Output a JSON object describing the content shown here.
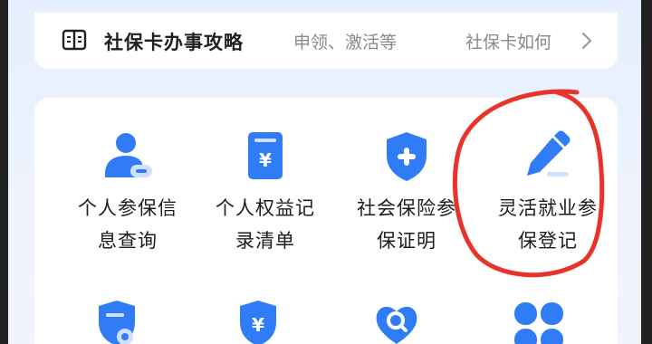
{
  "strategy": {
    "title": "社保卡办事攻略",
    "marquee_1": "申领、激活等",
    "marquee_2": "社保卡如何"
  },
  "services": [
    {
      "line1": "个人参保信",
      "line2": "息查询",
      "icon": "user-minus-icon"
    },
    {
      "line1": "个人权益记",
      "line2": "录清单",
      "icon": "yuan-document-icon"
    },
    {
      "line1": "社会保险参",
      "line2": "保证明",
      "icon": "shield-plus-icon"
    },
    {
      "line1": "灵活就业参",
      "line2": "保登记",
      "icon": "pencil-edit-icon"
    }
  ],
  "services_bottom": [
    {
      "icon": "document-search-icon"
    },
    {
      "icon": "shield-yuan-icon"
    },
    {
      "icon": "heart-search-icon"
    },
    {
      "icon": "grid-apps-icon"
    }
  ],
  "colors": {
    "icon_blue": "#2f7cf6",
    "icon_light": "#cfe0ff",
    "annotation_red": "#e8332a"
  }
}
